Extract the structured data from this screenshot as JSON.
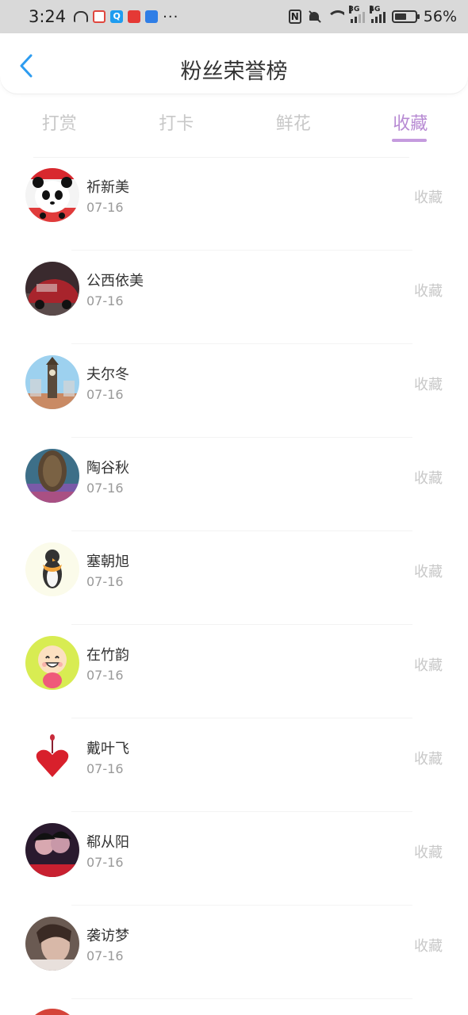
{
  "status_bar": {
    "time": "3:24",
    "battery_pct": "56%",
    "signal_1": "3G",
    "signal_2": "4G",
    "more": "···"
  },
  "header": {
    "title": "粉丝荣誉榜"
  },
  "tabs": [
    {
      "label": "打赏",
      "active": false
    },
    {
      "label": "打卡",
      "active": false
    },
    {
      "label": "鲜花",
      "active": false
    },
    {
      "label": "收藏",
      "active": true
    }
  ],
  "list": [
    {
      "name": "祈新美",
      "date": "07-16",
      "action": "收藏",
      "avatar": "panda-avatar"
    },
    {
      "name": "公西依美",
      "date": "07-16",
      "action": "收藏",
      "avatar": "car-avatar"
    },
    {
      "name": "夫尔冬",
      "date": "07-16",
      "action": "收藏",
      "avatar": "tower-avatar"
    },
    {
      "name": "陶谷秋",
      "date": "07-16",
      "action": "收藏",
      "avatar": "tree-avatar"
    },
    {
      "name": "塞朝旭",
      "date": "07-16",
      "action": "收藏",
      "avatar": "penguin-avatar"
    },
    {
      "name": "在竹韵",
      "date": "07-16",
      "action": "收藏",
      "avatar": "cartoon-avatar"
    },
    {
      "name": "戴叶飞",
      "date": "07-16",
      "action": "收藏",
      "avatar": "heart-avatar"
    },
    {
      "name": "郗从阳",
      "date": "07-16",
      "action": "收藏",
      "avatar": "couple-avatar"
    },
    {
      "name": "袭访梦",
      "date": "07-16",
      "action": "收藏",
      "avatar": "portrait-avatar"
    }
  ],
  "colors": {
    "accent": "#b78ad3",
    "tab_inactive": "#c8c8c8",
    "back_arrow": "#2d9cf0",
    "status_bar_bg": "#d9d9d9"
  }
}
